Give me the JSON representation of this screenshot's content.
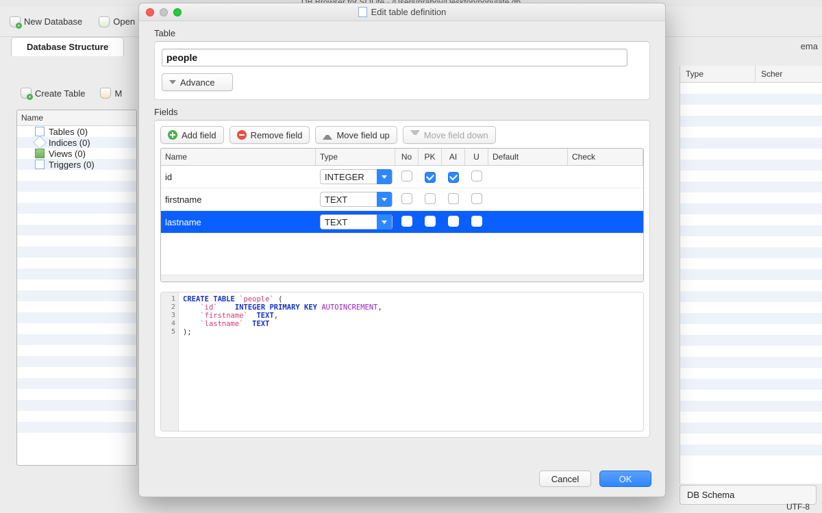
{
  "bg": {
    "title": "DB Browser for SQLite - /Users/nraboy/Desktop/populate.db",
    "toolbar": {
      "new_db": "New Database",
      "open_db": "Open"
    },
    "tab_active": "Database Structure",
    "right_tab_hint": "ema",
    "list_toolbar": {
      "create_table": "Create Table",
      "modify_table": "M"
    },
    "list_header": "Name",
    "items": [
      "Tables (0)",
      "Indices (0)",
      "Views (0)",
      "Triggers (0)"
    ],
    "right_cols": {
      "type": "Type",
      "schema": "Scher"
    },
    "db_schema_btn": "DB Schema",
    "encoding": "UTF-8"
  },
  "modal": {
    "title": "Edit table definition",
    "table_label": "Table",
    "table_name": "people",
    "adv_label": "Advance",
    "fields_label": "Fields",
    "buttons": {
      "add": "Add field",
      "remove": "Remove field",
      "up": "Move field up",
      "down": "Move field down"
    },
    "grid": {
      "head": {
        "name": "Name",
        "type": "Type",
        "no": "No",
        "pk": "PK",
        "ai": "AI",
        "u": "U",
        "def": "Default",
        "check": "Check"
      },
      "rows": [
        {
          "name": "id",
          "type": "INTEGER",
          "no": false,
          "pk": true,
          "ai": true,
          "u": false,
          "selected": false
        },
        {
          "name": "firstname",
          "type": "TEXT",
          "no": false,
          "pk": false,
          "ai": false,
          "u": false,
          "selected": false
        },
        {
          "name": "lastname",
          "type": "TEXT",
          "no": false,
          "pk": false,
          "ai": false,
          "u": false,
          "selected": true
        }
      ]
    },
    "sql": {
      "lines": [
        "1",
        "2",
        "3",
        "4",
        "5"
      ],
      "kw_create": "CREATE TABLE",
      "tbl": "`people`",
      "open": " (",
      "col_id_q": "`id`",
      "col_id_type": "INTEGER PRIMARY KEY",
      "col_id_ai": " AUTOINCREMENT",
      "comma1": ",",
      "col_fn_q": "`firstname`",
      "col_fn_type": "  TEXT",
      "comma2": ",",
      "col_ln_q": "`lastname`",
      "col_ln_type": "  TEXT",
      "close": ");"
    },
    "footer": {
      "cancel": "Cancel",
      "ok": "OK"
    }
  }
}
